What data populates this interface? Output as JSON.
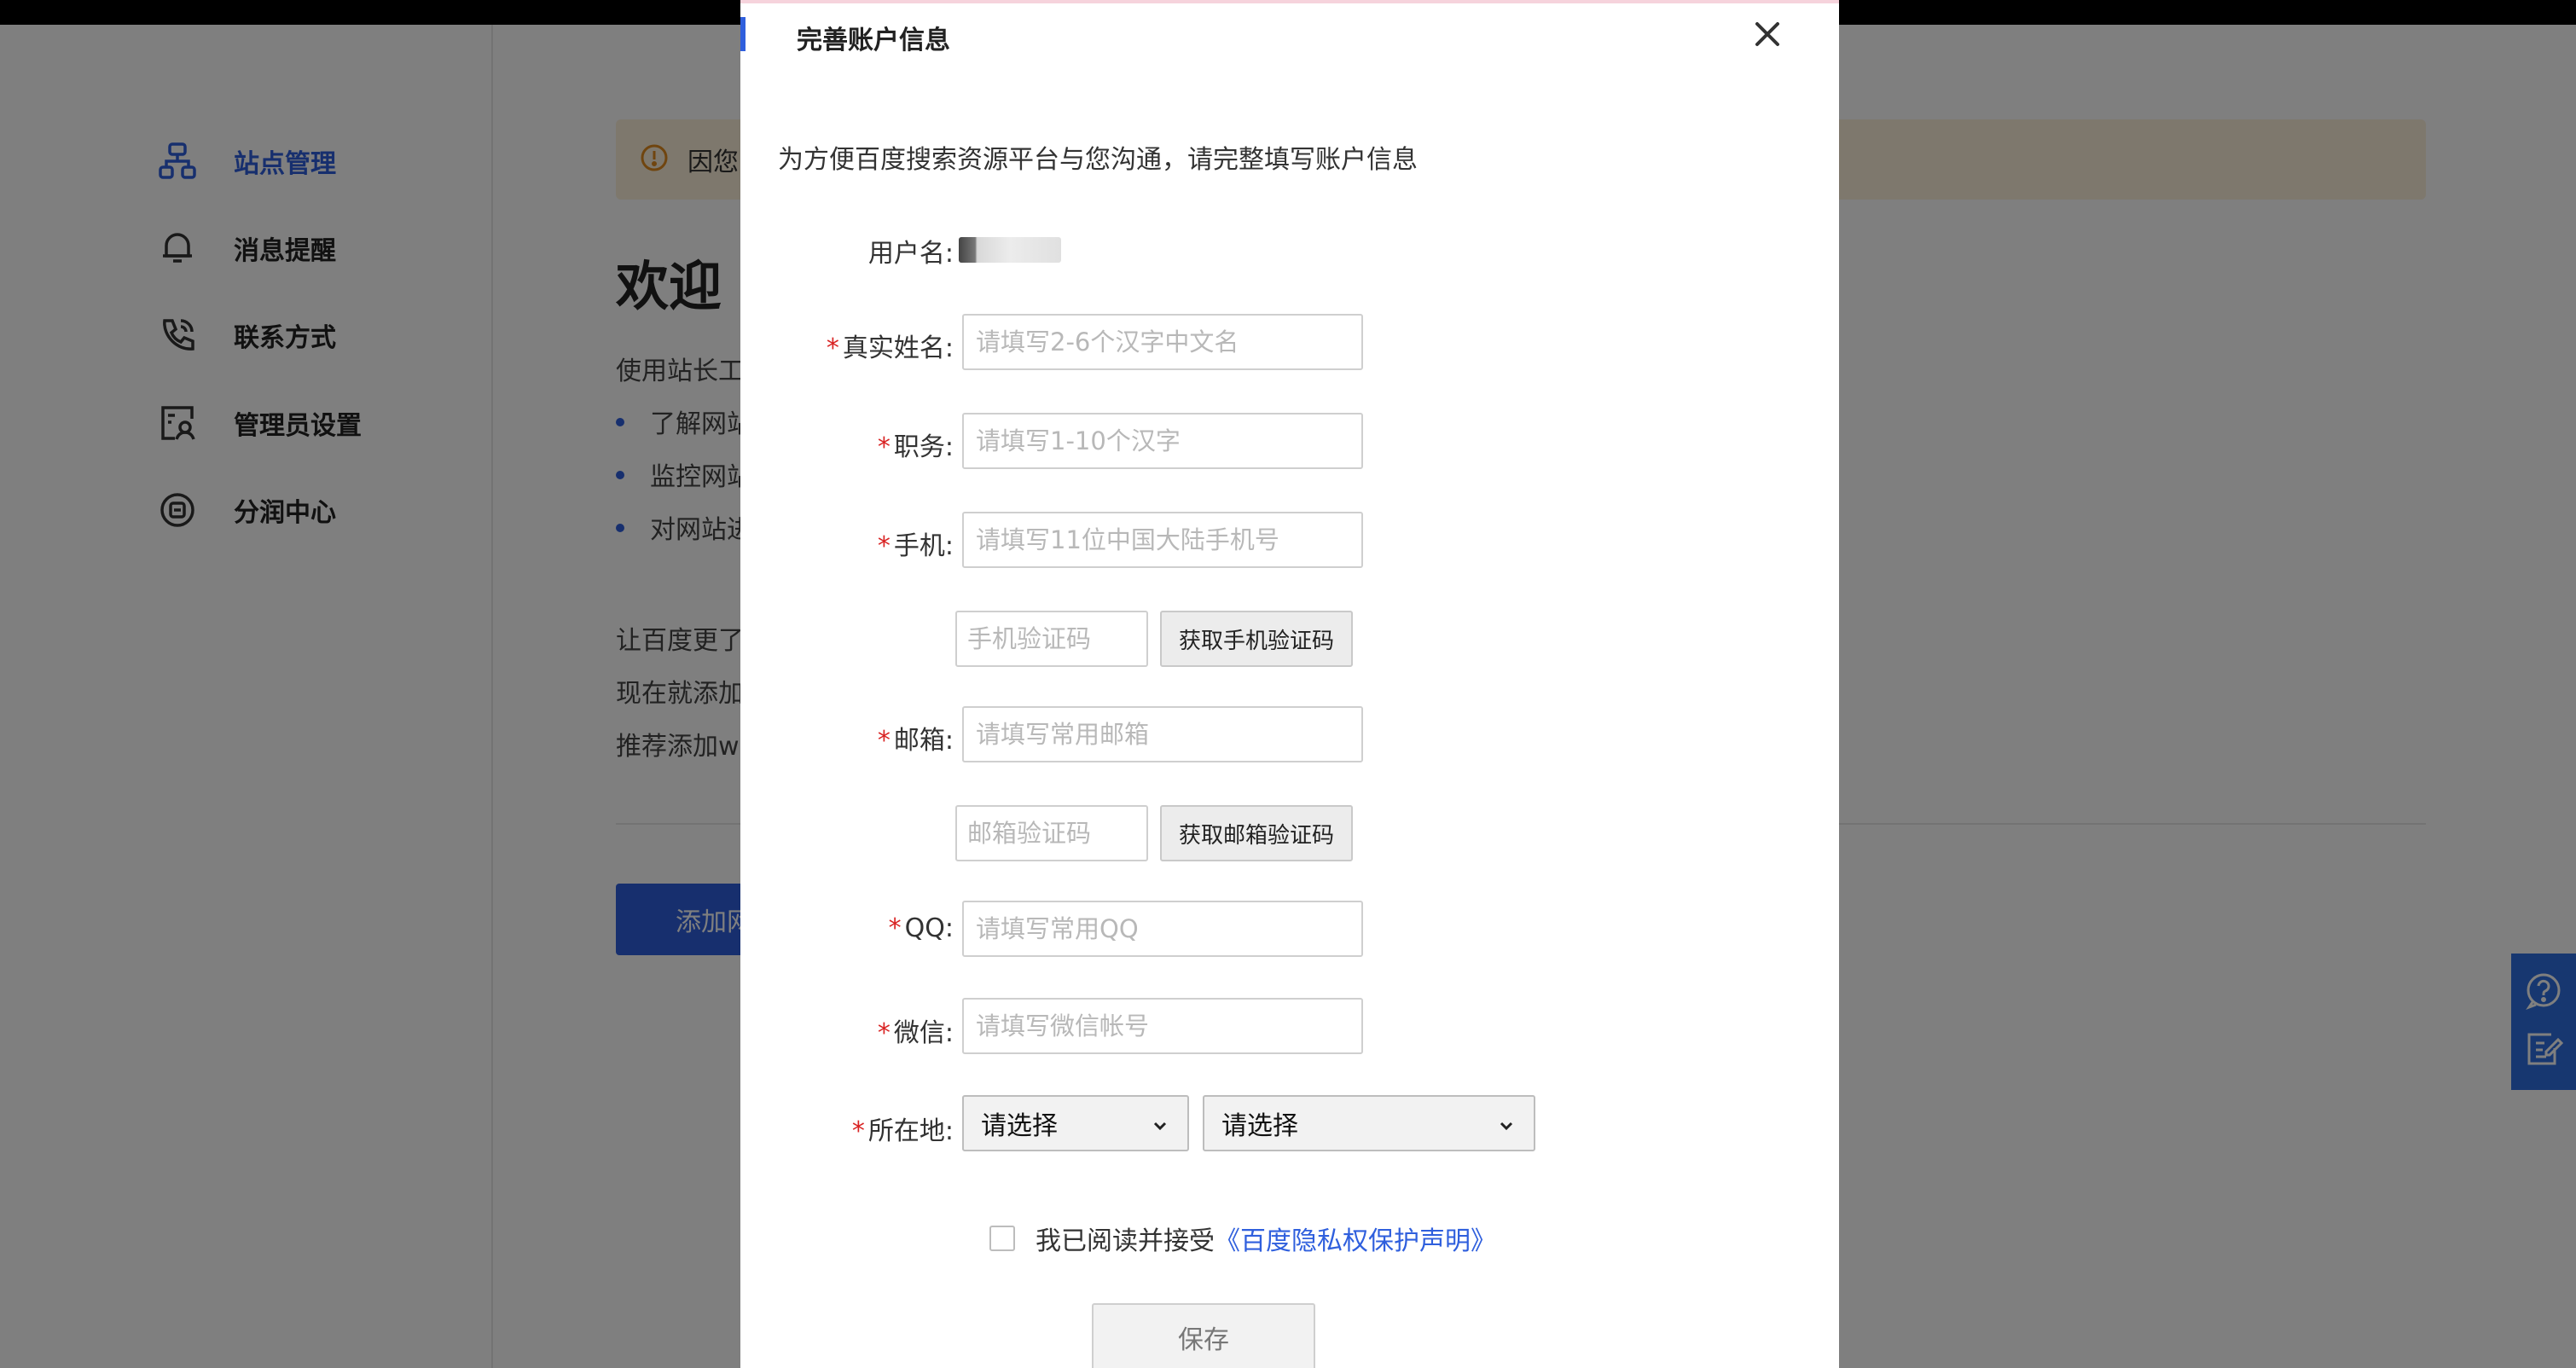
{
  "sidebar": {
    "items": [
      {
        "label": "站点管理",
        "icon": "sitemap-icon",
        "active": true
      },
      {
        "label": "消息提醒",
        "icon": "bell-icon"
      },
      {
        "label": "联系方式",
        "icon": "phone-icon"
      },
      {
        "label": "管理员设置",
        "icon": "admin-icon"
      },
      {
        "label": "分润中心",
        "icon": "target-icon"
      }
    ]
  },
  "main": {
    "notice_text": "因您",
    "welcome_title": "欢迎",
    "intro_line": "使用站长工",
    "bullets": [
      "了解网站",
      "监控网站",
      "对网站进"
    ],
    "lines": [
      "让百度更了",
      "现在就添加",
      "推荐添加w"
    ],
    "add_button_label": "添加网"
  },
  "modal": {
    "title": "完善账户信息",
    "intro": "为方便百度搜索资源平台与您沟通，请完整填写账户信息",
    "fields": {
      "username": {
        "label": "用户名:"
      },
      "real_name": {
        "label": "真实姓名:",
        "placeholder": "请填写2-6个汉字中文名"
      },
      "position": {
        "label": "职务:",
        "placeholder": "请填写1-10个汉字"
      },
      "phone": {
        "label": "手机:",
        "placeholder": "请填写11位中国大陆手机号"
      },
      "phone_code": {
        "placeholder": "手机验证码",
        "button": "获取手机验证码"
      },
      "email": {
        "label": "邮箱:",
        "placeholder": "请填写常用邮箱"
      },
      "email_code": {
        "placeholder": "邮箱验证码",
        "button": "获取邮箱验证码"
      },
      "qq": {
        "label": "QQ:",
        "placeholder": "请填写常用QQ"
      },
      "wechat": {
        "label": "微信:",
        "placeholder": "请填写微信帐号"
      },
      "location": {
        "label": "所在地:",
        "province": "请选择",
        "city": "请选择"
      }
    },
    "required_mark": "*",
    "agree_text": "我已阅读并接受",
    "agree_link": "《百度隐私权保护声明》",
    "save_label": "保存"
  },
  "colors": {
    "accent": "#2f5fdd",
    "required": "#d92323",
    "notice_bg": "#fdf1da",
    "float_tools": "#2f6fe0"
  }
}
